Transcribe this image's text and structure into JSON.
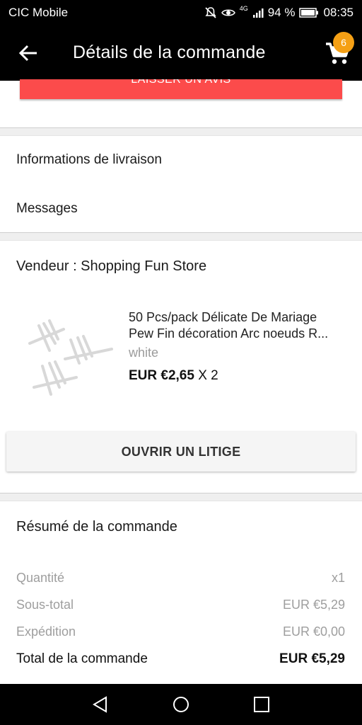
{
  "status_bar": {
    "carrier": "CIC Mobile",
    "network": "4G",
    "battery": "94 %",
    "time": "08:35"
  },
  "app_bar": {
    "title": "Détails de la commande",
    "cart_count": "6"
  },
  "actions": {
    "leave_review": "LAISSER UN AVIS",
    "open_dispute": "OUVRIR UN LITIGE"
  },
  "links": {
    "delivery_info": "Informations de livraison",
    "messages": "Messages"
  },
  "seller": {
    "label": "Vendeur : Shopping Fun Store"
  },
  "product": {
    "title_line1": "50 Pcs/pack Délicate De Mariage",
    "title_line2": "Pew Fin décoration Arc noeuds R...",
    "variant": "white",
    "price": "EUR €2,65",
    "quantity": "X 2"
  },
  "summary": {
    "title": "Résumé de la commande",
    "rows": [
      {
        "label": "Quantité",
        "value": "x1"
      },
      {
        "label": "Sous-total",
        "value": "EUR €5,29"
      },
      {
        "label": "Expédition",
        "value": "EUR €0,00"
      }
    ],
    "total_label": "Total de la commande",
    "total_value": "EUR €5,29"
  },
  "colors": {
    "accent_red": "#fc4b4b",
    "badge_orange": "#f5a015"
  }
}
